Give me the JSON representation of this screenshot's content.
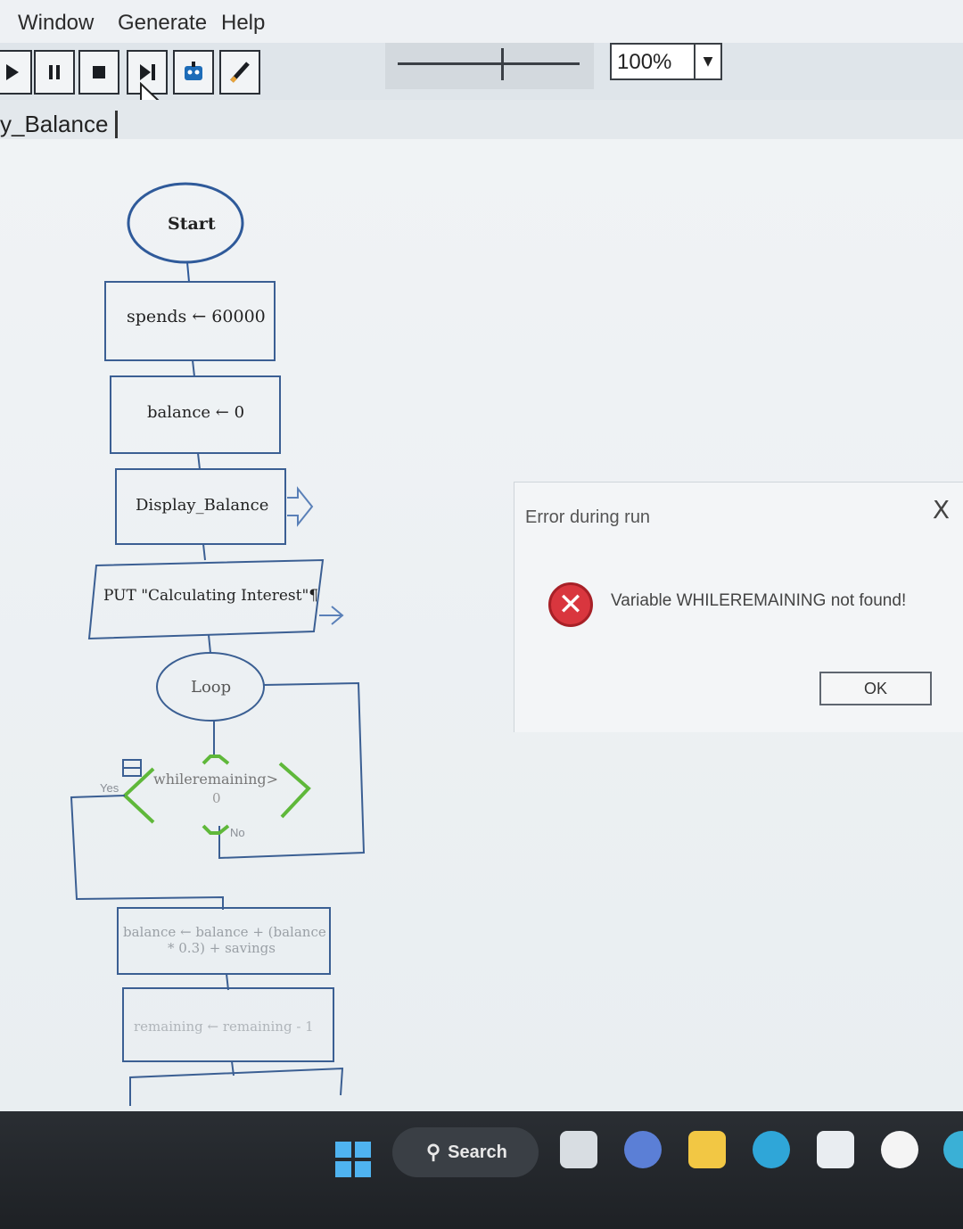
{
  "menu": [
    "Window",
    "Generate",
    "Help"
  ],
  "toolbar": {
    "buttons": [
      "play-icon",
      "pause-icon",
      "stop-icon",
      "step-icon",
      "robot-icon",
      "pen-icon"
    ],
    "zoom_value": "100%"
  },
  "tab": {
    "label": "y_Balance"
  },
  "flowchart": {
    "start": "Start",
    "spends": "spends ← 60000",
    "balance_init": "balance ← 0",
    "display": "Display_Balance",
    "put": "PUT \"Calculating Interest\"¶",
    "loop": "Loop",
    "condition_line1": "whileremaining>",
    "condition_line2": "0",
    "yes": "Yes",
    "no": "No",
    "calc_line1": "balance ← balance + (balance",
    "calc_line2": "* 0.3) + savings",
    "decrement": "remaining ← remaining - 1"
  },
  "dialog": {
    "title": "Error during run",
    "message": "Variable WHILEREMAINING not found!",
    "ok": "OK",
    "close": "X"
  },
  "taskbar": {
    "search": "Search"
  },
  "colors": {
    "start_oval": "#2f5a9a",
    "condition": "#5fb83a",
    "error": "#d9363e",
    "taskbar": "#23272b"
  }
}
